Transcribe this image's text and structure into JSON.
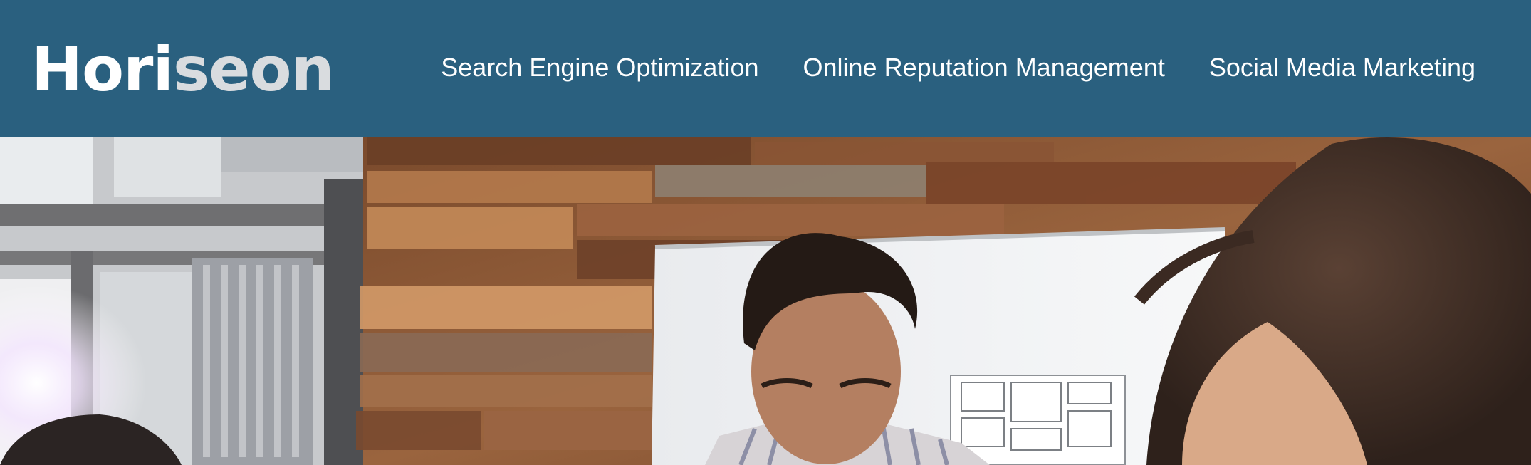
{
  "header": {
    "logo_part1": "Hori",
    "logo_part2": "seon",
    "nav": [
      {
        "label": "Search Engine Optimization"
      },
      {
        "label": "Online Reputation Management"
      },
      {
        "label": "Social Media Marketing"
      }
    ]
  },
  "hero": {
    "image": "team meeting photo: men at a table in front of a wood-plank wall and whiteboard"
  },
  "colors": {
    "header_bg": "#2a607f",
    "logo_light": "#d9dcdf",
    "text": "#ffffff"
  }
}
